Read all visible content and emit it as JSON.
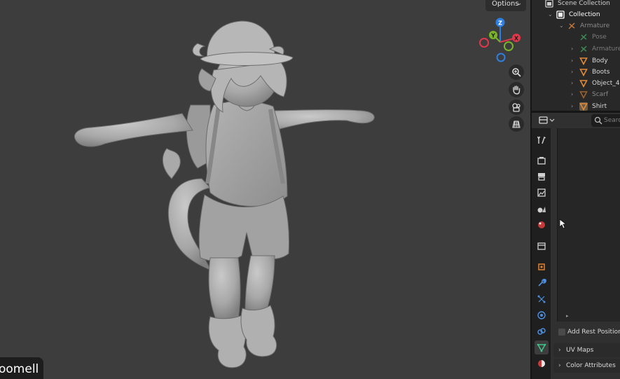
{
  "viewport": {
    "options_label": "Options",
    "caption": "oomell"
  },
  "gizmo": {
    "axes": [
      {
        "axis": "Z",
        "color": "#2f7fe0"
      },
      {
        "axis": "Y",
        "color": "#7ab528"
      },
      {
        "axis": "X",
        "color": "#e0384a"
      }
    ]
  },
  "nav_tools": [
    "zoom-icon",
    "hand-pan-icon",
    "camera-icon",
    "grid-view-icon"
  ],
  "outliner": {
    "rows": [
      {
        "label": "Scene Collection",
        "icon": "scene-collection-icon",
        "color": "#cfcfcf",
        "dim": false
      },
      {
        "label": "Collection",
        "icon": "collection-icon",
        "color": "#ffffff",
        "dim": false
      },
      {
        "label": "Armature",
        "icon": "armature-icon",
        "color": "#8a8a8a",
        "dim": true
      },
      {
        "label": "Pose",
        "icon": "pose-icon",
        "color": "#7a7a7a",
        "dim": true
      },
      {
        "label": "Armature",
        "icon": "armature-data-icon",
        "color": "#7a7a7a",
        "dim": true
      },
      {
        "label": "Body",
        "icon": "mesh-icon",
        "color": "#d8d8d8",
        "dim": false
      },
      {
        "label": "Boots",
        "icon": "mesh-icon",
        "color": "#d8d8d8",
        "dim": false
      },
      {
        "label": "Object_4",
        "icon": "mesh-icon",
        "color": "#d8d8d8",
        "dim": false
      },
      {
        "label": "Scarf",
        "icon": "mesh-icon",
        "color": "#8a8a8a",
        "dim": true
      },
      {
        "label": "Shirt",
        "icon": "mesh-icon",
        "color": "#d8d8d8",
        "dim": false
      }
    ]
  },
  "properties": {
    "search_placeholder": "Search",
    "tabs": [
      "tool-icon",
      "render-icon",
      "output-icon",
      "view-layer-icon",
      "scene-icon",
      "world-icon",
      "collection-tab-icon",
      "object-icon",
      "modifier-icon",
      "particles-icon",
      "physics-icon",
      "constraints-icon",
      "data-icon",
      "material-icon"
    ],
    "active_tab": "data-icon",
    "add_rest_position_label": "Add Rest Position",
    "panels": [
      "UV Maps",
      "Color Attributes"
    ]
  }
}
